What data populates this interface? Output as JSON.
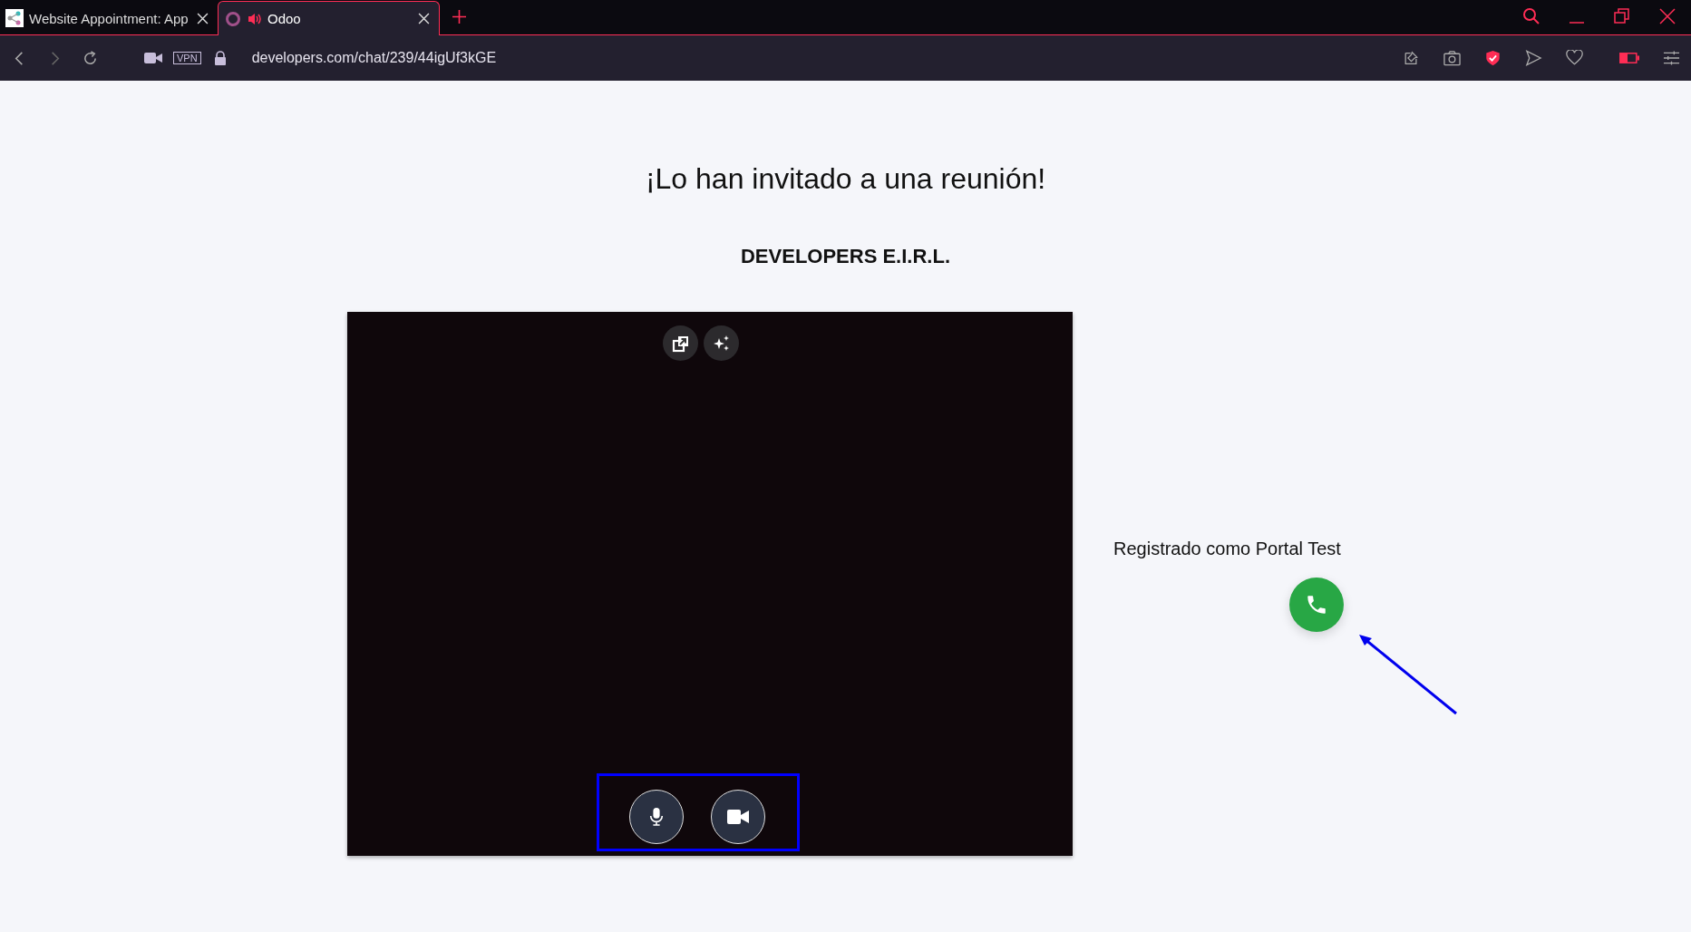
{
  "browser": {
    "tabs": [
      {
        "title": "Website Appointment: App",
        "selected": false,
        "kind": "share"
      },
      {
        "title": "Odoo",
        "selected": true,
        "kind": "odoo"
      }
    ],
    "address": "developers.com/chat/239/44igUf3kGE",
    "vpn": "VPN"
  },
  "page": {
    "heading": "¡Lo han invitado a una reunión!",
    "company": "DEVELOPERS E.I.R.L.",
    "status": "Registrado como Portal Test"
  }
}
